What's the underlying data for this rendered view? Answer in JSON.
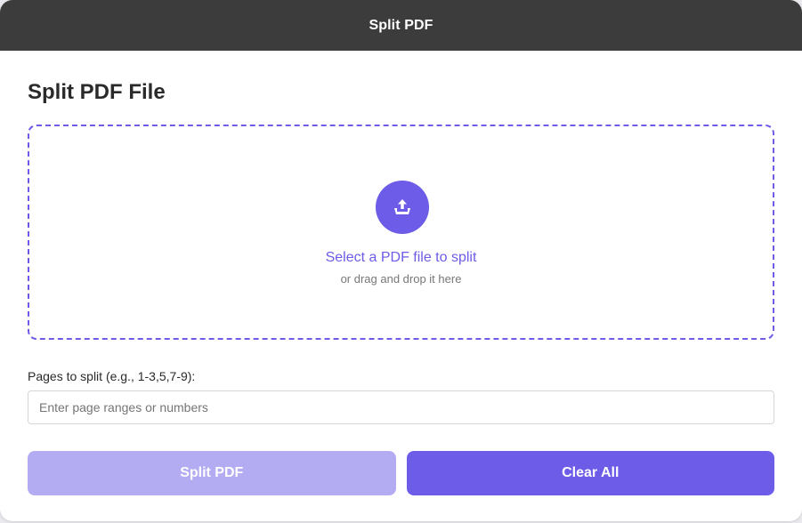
{
  "header": {
    "title": "Split PDF"
  },
  "main": {
    "title": "Split PDF File",
    "dropzone": {
      "icon": "upload-icon",
      "primary_text": "Select a PDF file to split",
      "secondary_text": "or drag and drop it here"
    },
    "pages": {
      "label": "Pages to split (e.g., 1-3,5,7-9):",
      "value": "",
      "placeholder": "Enter page ranges or numbers"
    },
    "buttons": {
      "split_label": "Split PDF",
      "clear_label": "Clear All"
    }
  },
  "colors": {
    "accent": "#6c5ce7",
    "accent_disabled": "#b3acf2",
    "header_bg": "#3c3c3c"
  }
}
